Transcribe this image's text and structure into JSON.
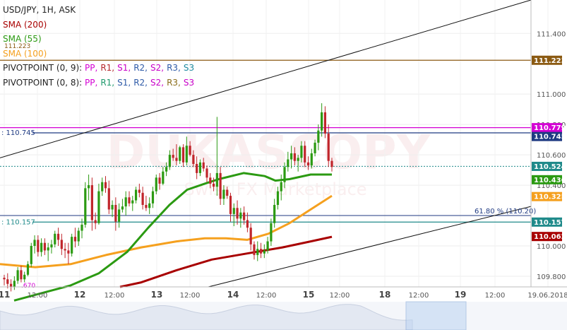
{
  "legend": {
    "symbol": "USD/JPY, 1H, ASK",
    "sma200": "SMA (200)",
    "sma55": "SMA (55)",
    "sma100": "SMA (100)",
    "sma100_value": "111.223",
    "pivot1_label": "PIVOTPOINT (0, 9):",
    "pivot1_items": [
      "PP,",
      "R1,",
      "S1,",
      "R2,",
      "S2,",
      "R3,",
      "S3"
    ],
    "pivot1_colors": [
      "#d400d4",
      "#b5282d",
      "#c800c8",
      "#2f5ba8",
      "#c800c8",
      "#2f5ba8",
      "#1e8aa0"
    ],
    "pivot2_label": "PIVOTPOINT (0, 8):",
    "pivot2_items": [
      "PP,",
      "R1,",
      "S1,",
      "R2,",
      "S2,",
      "R3,",
      "S3"
    ],
    "pivot2_colors": [
      "#d400d4",
      "#1f9a6d",
      "#2f5ba8",
      "#2f5ba8",
      "#c800c8",
      "#8a6d1a",
      "#c800c8"
    ]
  },
  "colors": {
    "sma200": "#a80000",
    "sma55": "#2b9a12",
    "sma100": "#f5a01e",
    "bull": "#2b9a12",
    "bear": "#c0252b",
    "resistance": "#8b5a12",
    "pp": "#d400d4",
    "pivot_blue": "#1f3a82",
    "support": "#1f8a8a",
    "last": "#1f8a8a",
    "fib": "#1f3a82",
    "trend": "#111111"
  },
  "annotations": {
    "fib_label": "61.80 % (110.20)",
    "left_level_1": ": 110.745",
    "left_level_2": ": 110.157",
    "left_level_3": ".670",
    "watermark": "DUKASCOPY",
    "watermark_sub": "Swiss FX Marketplace"
  },
  "chart_data": {
    "type": "candlestick",
    "title": "USD/JPY, 1H, ASK",
    "ylim": [
      109.73,
      111.62
    ],
    "y_ticks": [
      "111.400",
      "111.000",
      "110.800",
      "110.600",
      "110.400",
      "110.000",
      "109.800"
    ],
    "x_ticks": [
      "11",
      "12:00",
      "12",
      "12:00",
      "13",
      "12:00",
      "14",
      "12:00",
      "15",
      "12:00",
      "18",
      "12:00",
      "19",
      "12:00",
      "19.06.2018"
    ],
    "price_tags": [
      {
        "label": "111.223",
        "value": 111.223,
        "color": "#8b5a12"
      },
      {
        "label": "110.779",
        "value": 110.779,
        "color": "#d400d4"
      },
      {
        "label": "110.745",
        "value": 110.745,
        "color": "#1f3a82"
      },
      {
        "label": "110.524",
        "value": 110.524,
        "color": "#1f8a8a"
      },
      {
        "label": "110.436",
        "value": 110.436,
        "color": "#2b9a12"
      },
      {
        "label": "110.325",
        "value": 110.325,
        "color": "#f5a01e"
      },
      {
        "label": "110.157",
        "value": 110.157,
        "color": "#1f8a8a"
      },
      {
        "label": "110.062",
        "value": 110.062,
        "color": "#a80000"
      }
    ],
    "candles": [
      [
        109.79,
        109.81,
        109.74,
        109.78
      ],
      [
        109.78,
        109.82,
        109.72,
        109.75
      ],
      [
        109.75,
        109.78,
        109.7,
        109.73
      ],
      [
        109.73,
        109.8,
        109.71,
        109.77
      ],
      [
        109.77,
        109.86,
        109.75,
        109.84
      ],
      [
        109.84,
        109.87,
        109.76,
        109.78
      ],
      [
        109.78,
        109.83,
        109.76,
        109.81
      ],
      [
        109.81,
        109.9,
        109.8,
        109.88
      ],
      [
        109.88,
        110.02,
        109.86,
        110.0
      ],
      [
        110.0,
        110.07,
        109.95,
        110.04
      ],
      [
        110.04,
        110.07,
        109.93,
        109.96
      ],
      [
        109.96,
        110.05,
        109.93,
        110.02
      ],
      [
        110.02,
        110.05,
        109.94,
        109.97
      ],
      [
        109.97,
        110.02,
        109.9,
        109.99
      ],
      [
        109.99,
        110.04,
        109.95,
        110.01
      ],
      [
        110.01,
        110.1,
        109.99,
        110.08
      ],
      [
        110.08,
        110.12,
        110.0,
        110.04
      ],
      [
        110.04,
        110.08,
        109.94,
        109.98
      ],
      [
        109.98,
        110.02,
        109.92,
        109.97
      ],
      [
        109.97,
        110.02,
        109.88,
        109.95
      ],
      [
        109.95,
        110.08,
        109.93,
        110.06
      ],
      [
        110.06,
        110.12,
        109.99,
        110.03
      ],
      [
        110.03,
        110.12,
        110.0,
        110.1
      ],
      [
        110.1,
        110.18,
        110.05,
        110.14
      ],
      [
        110.14,
        110.42,
        110.12,
        110.38
      ],
      [
        110.38,
        110.47,
        110.3,
        110.4
      ],
      [
        110.4,
        110.45,
        110.1,
        110.17
      ],
      [
        110.17,
        110.22,
        110.11,
        110.15
      ],
      [
        110.15,
        110.41,
        110.14,
        110.36
      ],
      [
        110.36,
        110.45,
        110.33,
        110.42
      ],
      [
        110.42,
        110.46,
        110.35,
        110.38
      ],
      [
        110.38,
        110.43,
        110.21,
        110.24
      ],
      [
        110.24,
        110.3,
        110.19,
        110.27
      ],
      [
        110.27,
        110.32,
        110.1,
        110.16
      ],
      [
        110.16,
        110.28,
        110.12,
        110.24
      ],
      [
        110.24,
        110.31,
        110.22,
        110.26
      ],
      [
        110.26,
        110.36,
        110.2,
        110.32
      ],
      [
        110.32,
        110.36,
        110.26,
        110.28
      ],
      [
        110.28,
        110.33,
        110.23,
        110.3
      ],
      [
        110.3,
        110.39,
        110.28,
        110.37
      ],
      [
        110.37,
        110.41,
        110.32,
        110.35
      ],
      [
        110.35,
        110.39,
        110.24,
        110.27
      ],
      [
        110.27,
        110.33,
        110.23,
        110.25
      ],
      [
        110.25,
        110.32,
        110.21,
        110.28
      ],
      [
        110.28,
        110.39,
        110.25,
        110.36
      ],
      [
        110.36,
        110.47,
        110.34,
        110.45
      ],
      [
        110.45,
        110.48,
        110.37,
        110.41
      ],
      [
        110.41,
        110.52,
        110.4,
        110.49
      ],
      [
        110.49,
        110.55,
        110.46,
        110.52
      ],
      [
        110.52,
        110.63,
        110.5,
        110.6
      ],
      [
        110.6,
        110.64,
        110.56,
        110.58
      ],
      [
        110.58,
        110.67,
        110.53,
        110.56
      ],
      [
        110.56,
        110.66,
        110.54,
        110.65
      ],
      [
        110.65,
        110.67,
        110.52,
        110.55
      ],
      [
        110.55,
        110.72,
        110.53,
        110.66
      ],
      [
        110.66,
        110.69,
        110.59,
        110.6
      ],
      [
        110.6,
        110.63,
        110.52,
        110.54
      ],
      [
        110.54,
        110.59,
        110.44,
        110.48
      ],
      [
        110.48,
        110.57,
        110.46,
        110.55
      ],
      [
        110.55,
        110.58,
        110.49,
        110.51
      ],
      [
        110.51,
        110.53,
        110.42,
        110.45
      ],
      [
        110.45,
        110.48,
        110.38,
        110.41
      ],
      [
        110.41,
        110.45,
        110.36,
        110.39
      ],
      [
        110.39,
        110.85,
        110.33,
        110.48
      ],
      [
        110.48,
        110.52,
        110.27,
        110.31
      ],
      [
        110.31,
        110.4,
        110.27,
        110.37
      ],
      [
        110.37,
        110.39,
        110.31,
        110.33
      ],
      [
        110.33,
        110.35,
        110.16,
        110.21
      ],
      [
        110.21,
        110.28,
        110.13,
        110.25
      ],
      [
        110.25,
        110.3,
        110.14,
        110.18
      ],
      [
        110.18,
        110.25,
        110.12,
        110.22
      ],
      [
        110.22,
        110.26,
        110.14,
        110.17
      ],
      [
        110.17,
        110.22,
        110.09,
        110.12
      ],
      [
        110.12,
        110.15,
        109.97,
        110.01
      ],
      [
        110.01,
        110.03,
        109.91,
        109.94
      ],
      [
        109.94,
        110.03,
        109.9,
        109.98
      ],
      [
        109.98,
        110.02,
        109.92,
        109.95
      ],
      [
        109.95,
        110.01,
        109.92,
        109.97
      ],
      [
        109.97,
        110.06,
        109.95,
        110.03
      ],
      [
        110.03,
        110.18,
        110.0,
        110.15
      ],
      [
        110.15,
        110.31,
        110.12,
        110.27
      ],
      [
        110.27,
        110.39,
        110.24,
        110.36
      ],
      [
        110.36,
        110.47,
        110.3,
        110.42
      ],
      [
        110.42,
        110.55,
        110.38,
        110.52
      ],
      [
        110.52,
        110.62,
        110.49,
        110.57
      ],
      [
        110.57,
        110.66,
        110.51,
        110.61
      ],
      [
        110.61,
        110.65,
        110.53,
        110.56
      ],
      [
        110.56,
        110.6,
        110.49,
        110.58
      ],
      [
        110.58,
        110.69,
        110.55,
        110.66
      ],
      [
        110.66,
        110.69,
        110.52,
        110.55
      ],
      [
        110.55,
        110.59,
        110.5,
        110.53
      ],
      [
        110.53,
        110.64,
        110.51,
        110.61
      ],
      [
        110.61,
        110.7,
        110.59,
        110.68
      ],
      [
        110.68,
        110.8,
        110.63,
        110.76
      ],
      [
        110.76,
        110.94,
        110.72,
        110.88
      ],
      [
        110.88,
        110.92,
        110.71,
        110.74
      ],
      [
        110.74,
        110.8,
        110.52,
        110.56
      ],
      [
        110.56,
        110.58,
        110.49,
        110.52
      ]
    ],
    "sma55": [
      [
        20,
        109.64
      ],
      [
        60,
        109.69
      ],
      [
        100,
        109.74
      ],
      [
        140,
        109.82
      ],
      [
        180,
        109.96
      ],
      [
        210,
        110.12
      ],
      [
        240,
        110.27
      ],
      [
        265,
        110.37
      ],
      [
        290,
        110.41
      ],
      [
        310,
        110.44
      ],
      [
        345,
        110.48
      ],
      [
        375,
        110.46
      ],
      [
        390,
        110.43
      ],
      [
        410,
        110.44
      ],
      [
        440,
        110.47
      ],
      [
        470,
        110.47
      ]
    ],
    "sma100": [
      [
        0,
        109.88
      ],
      [
        50,
        109.86
      ],
      [
        100,
        109.88
      ],
      [
        150,
        109.94
      ],
      [
        200,
        109.99
      ],
      [
        250,
        110.03
      ],
      [
        290,
        110.05
      ],
      [
        320,
        110.05
      ],
      [
        350,
        110.04
      ],
      [
        380,
        110.08
      ],
      [
        410,
        110.15
      ],
      [
        440,
        110.24
      ],
      [
        470,
        110.33
      ]
    ],
    "sma200": [
      [
        170,
        109.73
      ],
      [
        200,
        109.76
      ],
      [
        250,
        109.84
      ],
      [
        300,
        109.91
      ],
      [
        350,
        109.95
      ],
      [
        400,
        109.99
      ],
      [
        440,
        110.03
      ],
      [
        470,
        110.06
      ]
    ]
  }
}
